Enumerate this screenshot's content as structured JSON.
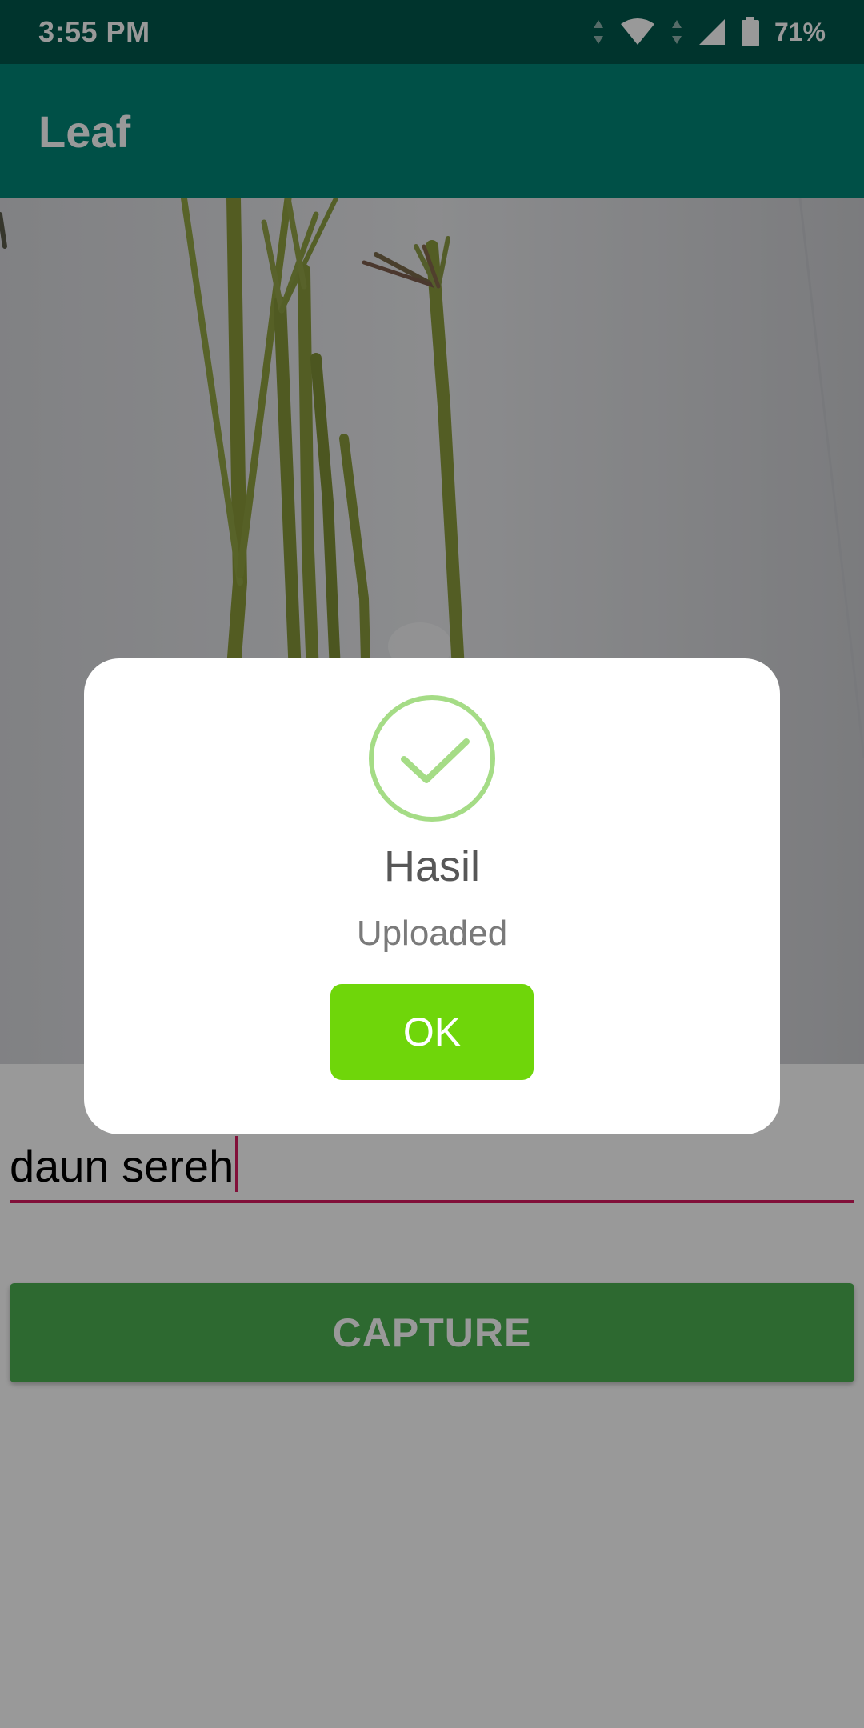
{
  "status_bar": {
    "time": "3:55 PM",
    "battery_percent": "71%",
    "icons": [
      "data-arrows-icon",
      "wifi-icon",
      "signal-icon",
      "battery-icon"
    ]
  },
  "app_bar": {
    "title": "Leaf"
  },
  "camera_preview": {
    "description_icon": "captured-photo"
  },
  "form": {
    "label_input_value": "daun sereh",
    "capture_button_label": "CAPTURE"
  },
  "dialog": {
    "icon": "check-circle-icon",
    "title": "Hasil",
    "message": "Uploaded",
    "ok_label": "OK"
  },
  "colors": {
    "status_bar": "#00574b",
    "app_bar": "#008577",
    "accent": "#d81b60",
    "capture_button": "#4caf50",
    "ok_button": "#6fd60a",
    "success_icon": "#a5dc86"
  }
}
